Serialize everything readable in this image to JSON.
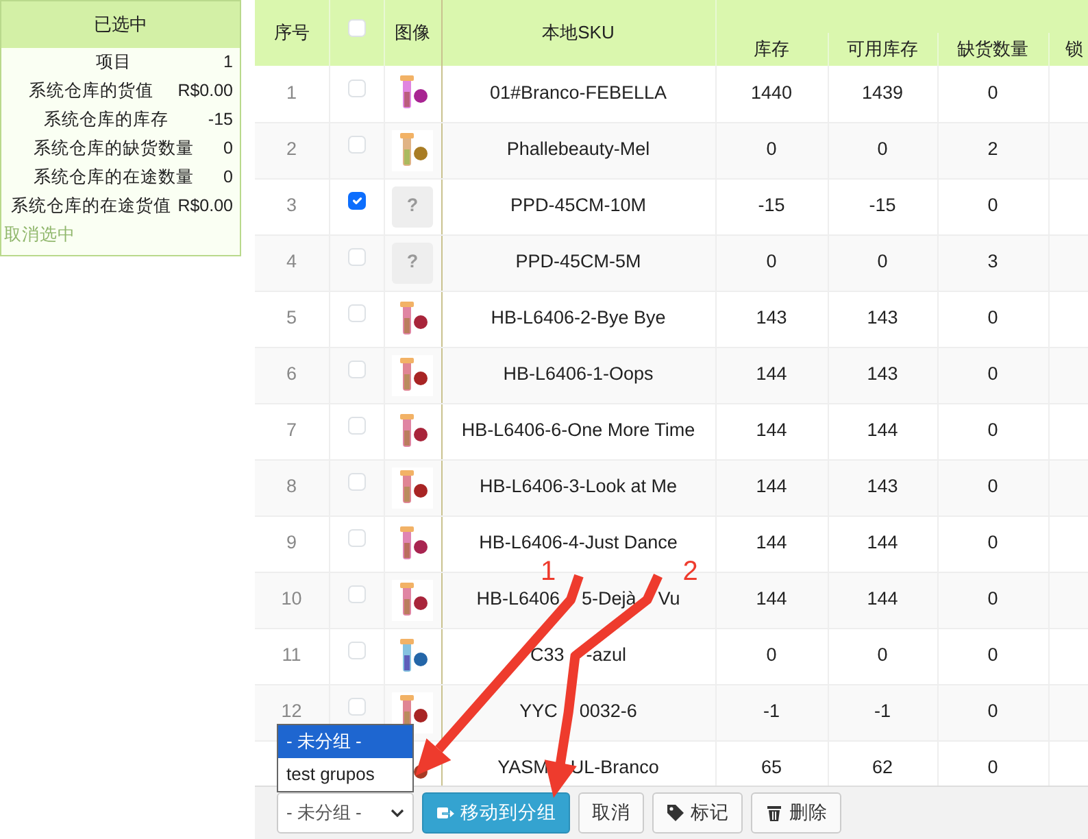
{
  "selection_panel": {
    "title": "已选中",
    "stats": [
      {
        "label": "项目",
        "value": "1"
      },
      {
        "label": "系统仓库的货值",
        "value": "R$0.00"
      },
      {
        "label": "系统仓库的库存",
        "value": "-15"
      },
      {
        "label": "系统仓库的缺货数量",
        "value": "0"
      },
      {
        "label": "系统仓库的在途数量",
        "value": "0"
      },
      {
        "label": "系统仓库的在途货值",
        "value": "R$0.00"
      }
    ],
    "clear_link": "取消选中"
  },
  "table": {
    "columns": {
      "no": "序号",
      "select_all": {
        "checked": false
      },
      "image": "图像",
      "sku": "本地SKU",
      "stock": "库存",
      "available": "可用库存",
      "shortage": "缺货数量",
      "column_8": "锁"
    },
    "rows": [
      {
        "no": "1",
        "checked": false,
        "image": {
          "kind": "picture"
        },
        "sku": "01#Branco-FEBELLA",
        "stock": "1440",
        "available": "1439",
        "shortage": "0"
      },
      {
        "no": "2",
        "checked": false,
        "image": {
          "kind": "picture"
        },
        "sku": "Phallebeauty-Mel",
        "stock": "0",
        "available": "0",
        "shortage": "2"
      },
      {
        "no": "3",
        "checked": true,
        "image": {
          "kind": "placeholder",
          "text": "?"
        },
        "sku": "PPD-45CM-10M",
        "stock": "-15",
        "available": "-15",
        "shortage": "0"
      },
      {
        "no": "4",
        "checked": false,
        "image": {
          "kind": "placeholder",
          "text": "?"
        },
        "sku": "PPD-45CM-5M",
        "stock": "0",
        "available": "0",
        "shortage": "3"
      },
      {
        "no": "5",
        "checked": false,
        "image": {
          "kind": "picture"
        },
        "sku": "HB-L6406-2-Bye Bye",
        "stock": "143",
        "available": "143",
        "shortage": "0"
      },
      {
        "no": "6",
        "checked": false,
        "image": {
          "kind": "picture"
        },
        "sku": "HB-L6406-1-Oops",
        "stock": "144",
        "available": "143",
        "shortage": "0"
      },
      {
        "no": "7",
        "checked": false,
        "image": {
          "kind": "picture"
        },
        "sku": "HB-L6406-6-One More Time",
        "stock": "144",
        "available": "144",
        "shortage": "0"
      },
      {
        "no": "8",
        "checked": false,
        "image": {
          "kind": "picture"
        },
        "sku": "HB-L6406-3-Look at Me",
        "stock": "144",
        "available": "143",
        "shortage": "0"
      },
      {
        "no": "9",
        "checked": false,
        "image": {
          "kind": "picture"
        },
        "sku": "HB-L6406-4-Just Dance",
        "stock": "144",
        "available": "144",
        "shortage": "0"
      },
      {
        "no": "10",
        "checked": false,
        "image": {
          "kind": "picture"
        },
        "sku_parts": [
          "HB-L6406",
          "5-Dejà",
          "Vu"
        ],
        "stock": "144",
        "available": "144",
        "shortage": "0"
      },
      {
        "no": "11",
        "checked": false,
        "image": {
          "kind": "picture"
        },
        "sku_parts": [
          "C33",
          "-azul"
        ],
        "stock": "0",
        "available": "0",
        "shortage": "0"
      },
      {
        "no": "12",
        "checked": false,
        "image": {
          "kind": "picture"
        },
        "sku_parts": [
          "YYC",
          "0032-6"
        ],
        "stock": "-1",
        "available": "-1",
        "shortage": "0"
      },
      {
        "image": {
          "kind": "picture"
        },
        "sku_parts": [
          "YASM",
          "UL-Branco"
        ],
        "stock": "65",
        "available": "62",
        "shortage": "0"
      }
    ]
  },
  "toolbar": {
    "group_select": {
      "value": "- 未分组 -",
      "expanded": true,
      "options": [
        {
          "label": "- 未分组 -",
          "selected": true
        },
        {
          "label": "test grupos",
          "selected": false
        }
      ]
    },
    "buttons": [
      {
        "kind": "primary",
        "label": "移动到分组"
      },
      {
        "kind": "default",
        "label": "取消"
      },
      {
        "kind": "default",
        "label": "标记"
      },
      {
        "kind": "default",
        "label": "删除"
      }
    ]
  },
  "annotations": [
    {
      "label": "1"
    },
    {
      "label": "2"
    }
  ]
}
